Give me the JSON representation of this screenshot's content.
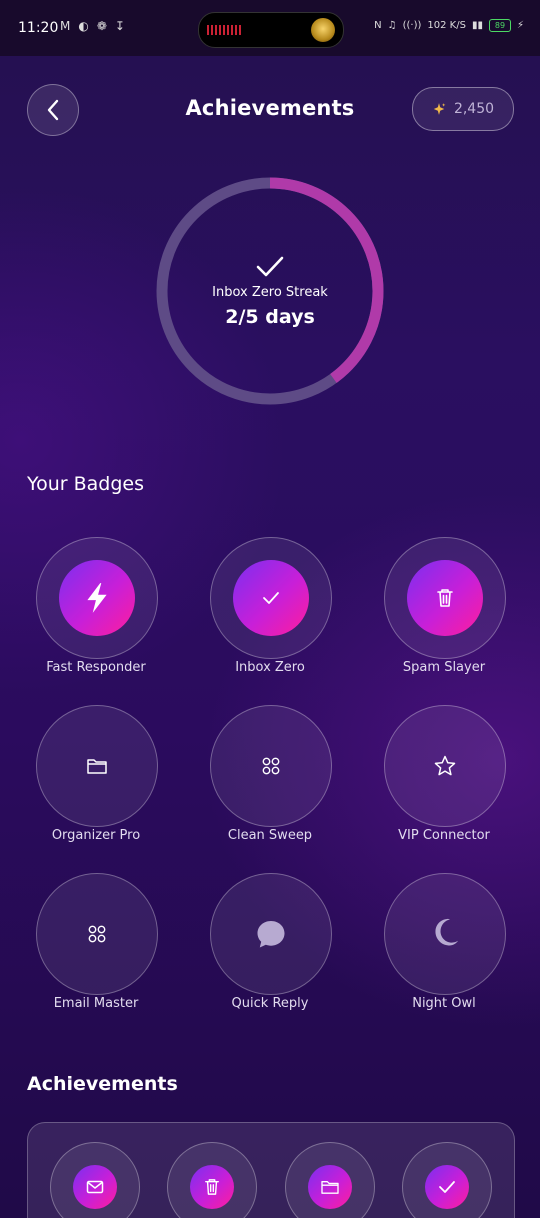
{
  "status_bar": {
    "time": "11:20",
    "net_speed": "102 K/S",
    "battery": "89"
  },
  "header": {
    "title": "Achievements",
    "points": "2,450"
  },
  "streak": {
    "label": "Inbox Zero Streak",
    "value": "2/5 days",
    "progress_fraction": 0.4,
    "progress_color": "#b03aa9",
    "track_color": "#5e4b86"
  },
  "badges_section": {
    "title": "Your Badges",
    "badges": [
      {
        "label": "Fast Responder",
        "icon": "lightning-icon",
        "earned": true
      },
      {
        "label": "Inbox Zero",
        "icon": "check-icon",
        "earned": true
      },
      {
        "label": "Spam Slayer",
        "icon": "trash-icon",
        "earned": true
      },
      {
        "label": "Organizer Pro",
        "icon": "folder-icon",
        "earned": false
      },
      {
        "label": "Clean Sweep",
        "icon": "grid-icon",
        "earned": false
      },
      {
        "label": "VIP Connector",
        "icon": "star-icon",
        "earned": false
      },
      {
        "label": "Email Master",
        "icon": "grid-icon",
        "earned": false
      },
      {
        "label": "Quick Reply",
        "icon": "chat-bubble-icon",
        "earned": false
      },
      {
        "label": "Night Owl",
        "icon": "moon-icon",
        "earned": false
      }
    ]
  },
  "achievements_section": {
    "title": "Achievements",
    "items": [
      {
        "icon": "mail-icon"
      },
      {
        "icon": "trash-icon"
      },
      {
        "icon": "folder-icon"
      },
      {
        "icon": "check-icon"
      }
    ]
  },
  "colors": {
    "accent_gradient_start": "#7b2ff0",
    "accent_gradient_end": "#ff1e9c"
  }
}
